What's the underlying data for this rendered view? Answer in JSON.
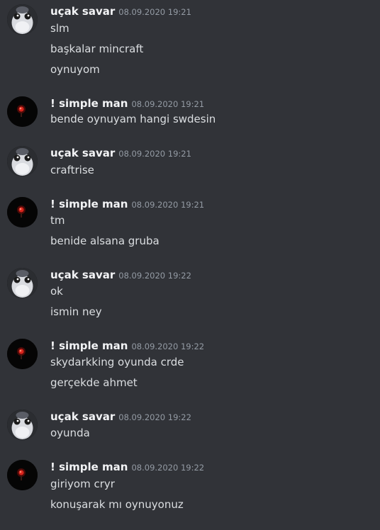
{
  "messages": [
    {
      "author": "uçak savar",
      "avatar": "duck-avatar",
      "time": "08.09.2020 19:21",
      "lines": [
        "slm",
        "başkalar mincraft",
        "oynuyom"
      ]
    },
    {
      "author": "! simple man",
      "avatar": "red-light-avatar",
      "time": "08.09.2020 19:21",
      "lines": [
        "bende oynuyam hangi swdesin"
      ]
    },
    {
      "author": "uçak savar",
      "avatar": "duck-avatar",
      "time": "08.09.2020 19:21",
      "lines": [
        "craftrise"
      ]
    },
    {
      "author": "! simple man",
      "avatar": "red-light-avatar",
      "time": "08.09.2020 19:21",
      "lines": [
        "tm",
        "benide alsana gruba"
      ]
    },
    {
      "author": "uçak savar",
      "avatar": "duck-avatar",
      "time": "08.09.2020 19:22",
      "lines": [
        "ok",
        "ismin ney"
      ]
    },
    {
      "author": "! simple man",
      "avatar": "red-light-avatar",
      "time": "08.09.2020 19:22",
      "lines": [
        "skydarkking oyunda crde",
        "gerçekde ahmet"
      ]
    },
    {
      "author": "uçak savar",
      "avatar": "duck-avatar",
      "time": "08.09.2020 19:22",
      "lines": [
        "oyunda"
      ]
    },
    {
      "author": "! simple man",
      "avatar": "red-light-avatar",
      "time": "08.09.2020 19:22",
      "lines": [
        "giriyom cryr",
        "konuşarak mı oynuyonuz"
      ]
    }
  ]
}
